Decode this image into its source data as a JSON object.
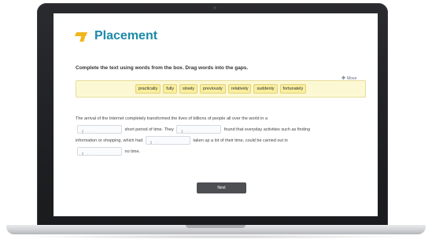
{
  "app": {
    "title": "Placement"
  },
  "question": {
    "instruction": "Complete the text using words from the box. Drag words into the gaps.",
    "move_label": "Move",
    "word_bank": [
      "practically",
      "fully",
      "slowly",
      "previously",
      "relatively",
      "suddenly",
      "fortunately"
    ],
    "passage": {
      "p1": "The arrival of the Internet completely transformed the lives of billions of people all over the world in a",
      "p2": "short period of time. They",
      "p3": "found that everyday activities such as finding",
      "p4": "information or shopping, which had",
      "p5": "taken up a lot of their time, could be carried out in",
      "p6": "no time."
    }
  },
  "footer": {
    "next_label": "Next"
  },
  "colors": {
    "brand": "#1b8aa8",
    "accent": "#f2b51c",
    "word_box_bg": "#fdf8d4",
    "button_bg": "#4d4f53"
  },
  "icons": {
    "brand": "placement-logo-icon",
    "move": "move-arrows-icon",
    "gap_handle": "drag-handle-icon"
  }
}
